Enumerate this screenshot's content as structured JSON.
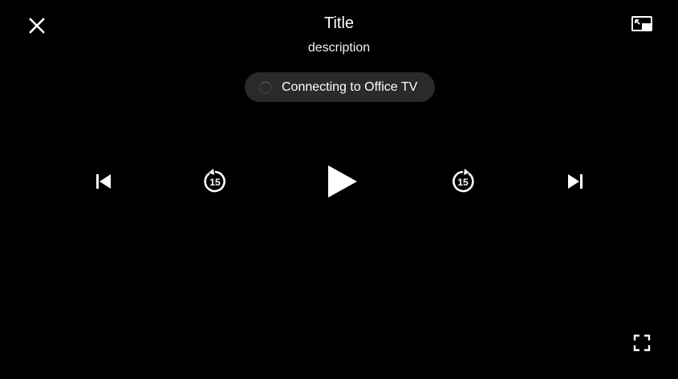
{
  "header": {
    "title": "Title",
    "description": "description"
  },
  "cast_status": {
    "text": "Connecting to Office TV",
    "icon": "spinner-icon"
  },
  "controls": {
    "previous_icon": "skip-previous-icon",
    "rewind_icon": "replay-15-icon",
    "rewind_seconds": "15",
    "play_icon": "play-icon",
    "forward_icon": "forward-15-icon",
    "forward_seconds": "15",
    "next_icon": "skip-next-icon"
  },
  "top_bar": {
    "close_icon": "close-icon",
    "pip_icon": "picture-in-picture-icon"
  },
  "bottom_bar": {
    "fullscreen_icon": "fullscreen-icon"
  },
  "colors": {
    "background": "#000000",
    "foreground": "#ffffff",
    "pill": "#2a2a2a"
  }
}
